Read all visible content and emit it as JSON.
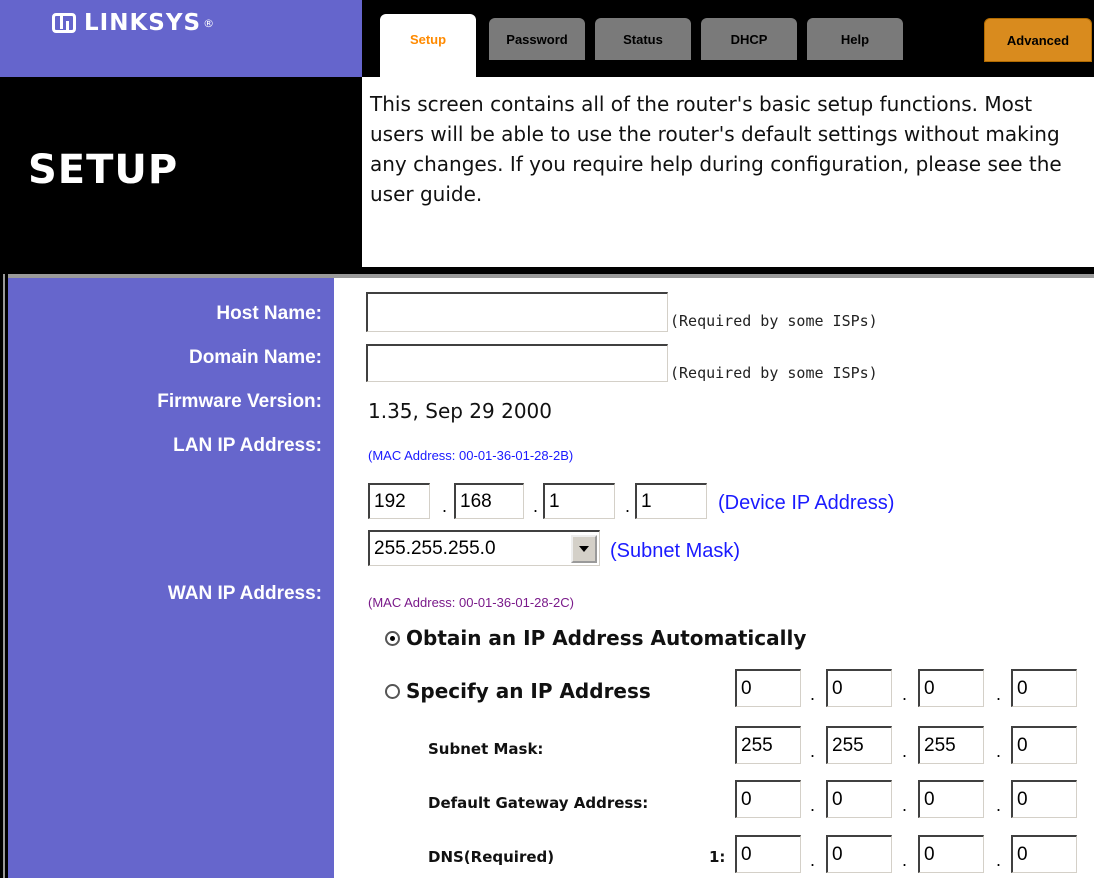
{
  "brand": {
    "name": "LINKSYS",
    "reg": "®"
  },
  "tabs": [
    {
      "label": "Setup",
      "active": true
    },
    {
      "label": "Password"
    },
    {
      "label": "Status"
    },
    {
      "label": "DHCP"
    },
    {
      "label": "Help"
    },
    {
      "label": "Advanced"
    }
  ],
  "page": {
    "title": "SETUP",
    "intro": "This screen contains all of the router's basic setup functions. Most users will be able to use the router's default settings without making any changes. If you require help during configuration, please see the user guide."
  },
  "form": {
    "host_name": {
      "label": "Host Name:",
      "value": "",
      "hint": "(Required by some ISPs)"
    },
    "domain_name": {
      "label": "Domain Name:",
      "value": "",
      "hint": "(Required by some ISPs)"
    },
    "firmware": {
      "label": "Firmware Version:",
      "value": "1.35, Sep 29 2000"
    },
    "lan": {
      "label": "LAN IP Address:",
      "mac": "(MAC Address: 00-01-36-01-28-2B)",
      "ip": [
        "192",
        "168",
        "1",
        "1"
      ],
      "ip_note": "(Device IP Address)",
      "subnet": "255.255.255.0",
      "subnet_note": "(Subnet Mask)"
    },
    "wan": {
      "label": "WAN IP Address:",
      "mac": "(MAC Address: 00-01-36-01-28-2C)",
      "obtain_label": "Obtain an IP Address Automatically",
      "specify_label": "Specify an IP Address",
      "specify_ip": [
        "0",
        "0",
        "0",
        "0"
      ],
      "subnet_label": "Subnet Mask:",
      "subnet": [
        "255",
        "255",
        "255",
        "0"
      ],
      "gateway_label": "Default Gateway Address:",
      "gateway": [
        "0",
        "0",
        "0",
        "0"
      ],
      "dns_label": "DNS(Required)",
      "dns_index": "1:",
      "dns1": [
        "0",
        "0",
        "0",
        "0"
      ]
    }
  },
  "colors": {
    "label_bg": "#6666cc",
    "brand_bg": "#6565cc",
    "tab_active_text": "#ff8a00",
    "advanced_tab": "#d98b1e"
  }
}
